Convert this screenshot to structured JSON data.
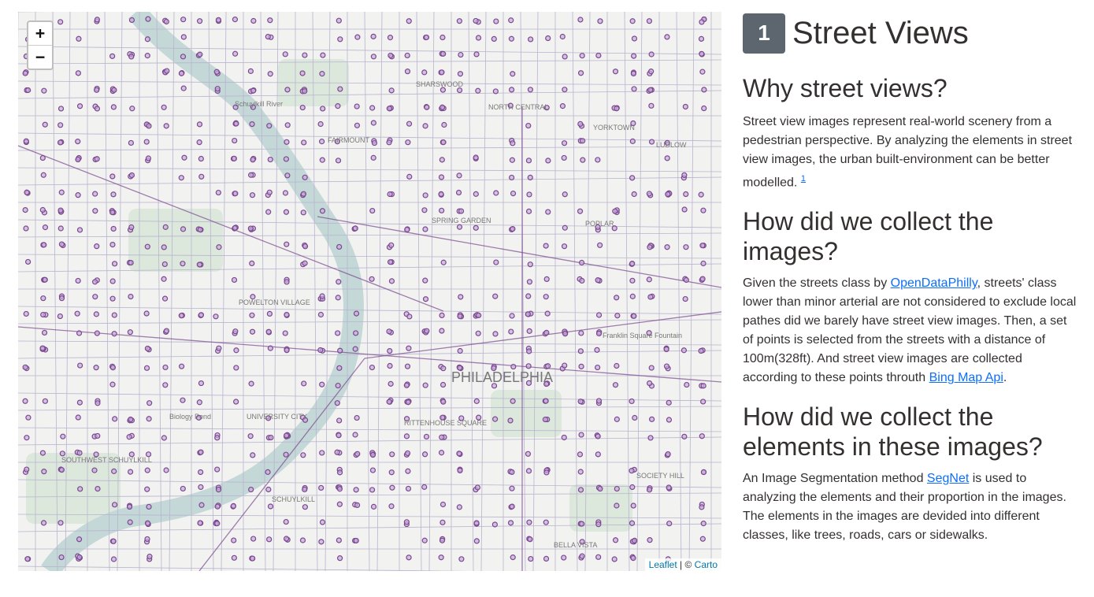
{
  "map": {
    "zoom_in": "+",
    "zoom_out": "−",
    "labels": {
      "sharswood": "SHARSWOOD",
      "north_central": "NORTH CENTRAL",
      "yorktown": "YORKTOWN",
      "fairmount": "FAIRMOUNT",
      "ludlow": "LUDLOW",
      "spring_garden": "SPRING GARDEN",
      "poplar": "POPLAR",
      "powelton_village": "POWELTON VILLAGE",
      "philadelphia": "PHILADELPHIA",
      "university_city": "UNIVERSITY CITY",
      "rittenhouse_square": "RITTENHOUSE SQUARE",
      "southwest_schuylkill": "SOUTHWEST SCHUYLKILL",
      "schuylkill": "SCHUYLKILL",
      "society_hill": "SOCIETY HILL",
      "bella_vista": "BELLA VISTA",
      "biology_pond": "Biology Pond",
      "franklin_square": "Franklin Square Fountain",
      "schuylkill_river": "Schuylkill River"
    },
    "attribution_leaflet": "Leaflet",
    "attribution_sep": " | © ",
    "attribution_carto": "Carto",
    "colors": {
      "point": "#7a4a8f",
      "road": "#b8b4cf",
      "river": "#c4d8d8",
      "park": "#dde8dd"
    }
  },
  "panel": {
    "number": "1",
    "title": "Street Views",
    "sections": [
      {
        "heading": "Why street views?",
        "text": "Street view images represent real-world scenery from a pedestrian perspective. By analyzing the elements in street view images, the urban built-environment can be better modelled.",
        "footnote": "1"
      },
      {
        "heading": "How did we collect the images?",
        "text_before": "Given the streets class by ",
        "link1": "OpenDataPhilly",
        "text_middle": ", streets' class lower than minor arterial are not considered to exclude local pathes did we barely have street view images. Then, a set of points is selected from the streets with a distance of 100m(328ft). And street view images are collected according to these points throuth ",
        "link2": "Bing Map Api",
        "text_after": "."
      },
      {
        "heading": "How did we collect the elements in these images?",
        "text_before": "An Image Segmentation method ",
        "link": "SegNet",
        "text_after": " is used to analyzing the elements and their proportion in the images. The elements in the images are devided into different classes, like trees, roads, cars or sidewalks."
      }
    ]
  }
}
